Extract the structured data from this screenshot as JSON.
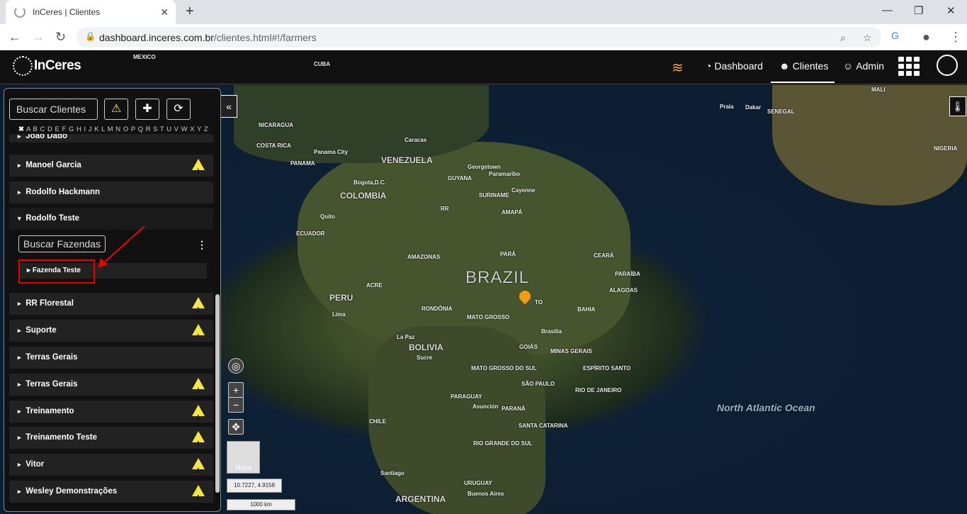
{
  "browser": {
    "tab_title": "InCeres | Clientes",
    "url_host": "dashboard.inceres.com.br",
    "url_path": "/clientes.html#!/farmers"
  },
  "header": {
    "logo": "InCeres",
    "nav": [
      "Dashboard",
      "Clientes",
      "Admin"
    ]
  },
  "sidebar": {
    "search_placeholder": "Buscar Clientes",
    "alphabet": "A B C D E F G H I J K L M N O P Q R S T U V W X Y Z",
    "alphabet_clear": "✖",
    "partial_row": "João Dado",
    "clients": [
      {
        "name": "Manoel Garcia",
        "warning": true
      },
      {
        "name": "Rodolfo Hackmann",
        "warning": false
      },
      {
        "name": "Rodolfo Teste",
        "warning": false,
        "expanded": true
      },
      {
        "name": "RR Florestal",
        "warning": true
      },
      {
        "name": "Suporte",
        "warning": true
      },
      {
        "name": "Terras Gerais",
        "warning": false
      },
      {
        "name": "Terras Gerais",
        "warning": true
      },
      {
        "name": "Treinamento",
        "warning": true
      },
      {
        "name": "Treinamento Teste",
        "warning": true
      },
      {
        "name": "Vitor",
        "warning": true
      },
      {
        "name": "Wesley Demonstrações",
        "warning": true
      }
    ],
    "farm_search_placeholder": "Buscar Fazendas",
    "farm": "Fazenda Teste"
  },
  "map": {
    "labels": {
      "brazil": "BRAZIL",
      "peru": "PERU",
      "bolivia": "BOLIVIA",
      "colombia": "COLOMBIA",
      "venezuela": "VENEZUELA",
      "ecuador": "ECUADOR",
      "paraguay": "PARAGUAY",
      "chile": "CHILE",
      "argentina": "ARGENTINA",
      "uruguay": "URUGUAY",
      "guyana": "GUYANA",
      "suriname": "SURINAME",
      "panama": "PANAMA",
      "nicaragua": "NICARAGUA",
      "costa_rica": "COSTA RICA",
      "mexico": "MEXICO",
      "cuba": "CUBA",
      "mali": "MALI",
      "senegal": "SENEGAL",
      "nigeria": "NIGERIA",
      "ocean": "North Atlantic Ocean",
      "lima": "Lima",
      "brasilia": "Brasília",
      "la_paz": "La Paz",
      "sucre": "Sucre",
      "quito": "Quito",
      "bogota": "Bogota,D.C.",
      "caracas": "Caracas",
      "asuncion": "Asunción",
      "santiago": "Santiago",
      "buenos_aires": "Buenos Aires",
      "georgetown": "Georgetown",
      "paramaribo": "Paramaribo",
      "cayenne": "Cayenne",
      "panama_city": "Panama City",
      "dakar": "Dakar",
      "praia": "Praia",
      "amazonas": "AMAZONAS",
      "para": "PARÁ",
      "mato_grosso": "MATO GROSSO",
      "bahia": "BAHIA",
      "goias": "GOIÁS",
      "minas": "MINAS GERAIS",
      "sao_paulo": "SÃO PAULO",
      "parana": "PARANÁ",
      "rio": "RIO DE JANEIRO",
      "rs": "RIO GRANDE DO SUL",
      "sc": "SANTA CATARINA",
      "ms": "MATO GROSSO DO SUL",
      "ceara": "CEARÁ",
      "tocantins": "TO",
      "rondonia": "RONDÔNIA",
      "acre": "ACRE",
      "amapa": "AMAPÁ",
      "roraima": "RR",
      "es": "ESPÍRITO SANTO",
      "alagoas": "ALAGOAS",
      "paraiba": "PARAÍBA"
    },
    "coords": "10.7227, 4.9158",
    "scale": "1000 km",
    "base_layer": "Mapa"
  },
  "colors": {
    "accent": "#f5a623",
    "warning": "#f5e642",
    "highlight": "#e00000"
  }
}
